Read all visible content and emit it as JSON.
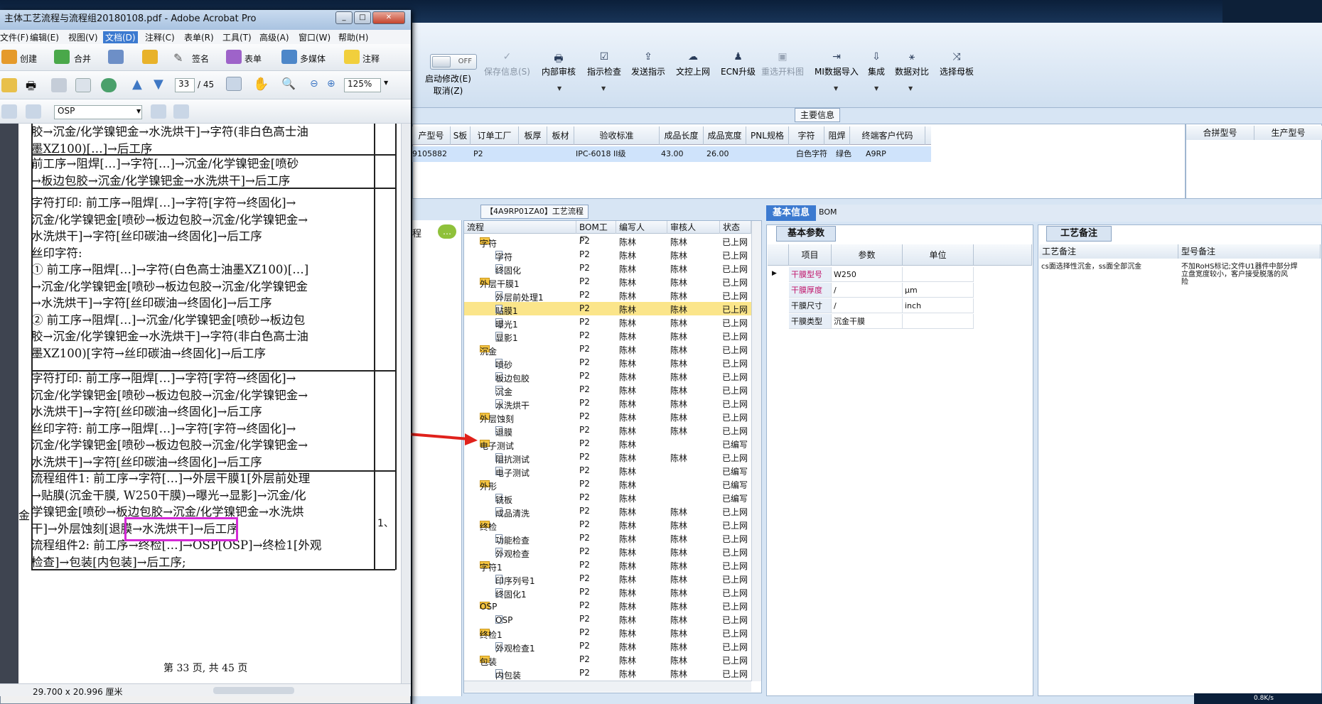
{
  "acrobat": {
    "title": "主体工艺流程与流程组20180108.pdf - Adobe Acrobat Pro",
    "menu": [
      "文件(F)",
      "编辑(E)",
      "视图(V)",
      "文档(D)",
      "注释(C)",
      "表单(R)",
      "工具(T)",
      "高级(A)",
      "窗口(W)",
      "帮助(H)"
    ],
    "toolbar1": [
      "创建",
      "合并",
      "签名",
      "表单",
      "多媒体",
      "注释"
    ],
    "page_current": "33",
    "page_total": "/ 45",
    "zoom": "125%",
    "layer_select": "OSP",
    "status_size": "29.700 x 20.996 厘米",
    "footer": "第 33 页, 共 45 页",
    "left_margin_text": "金",
    "right_margin_text": "1、",
    "doc_cells": [
      "胶→沉金/化学镍钯金→水洗烘干]→字符(非白色高士油\n墨XZ100)[…]→后工序",
      "前工序→阻焊[…]→字符[…]→沉金/化学镍钯金[喷砂\n→板边包胶→沉金/化学镍钯金→水洗烘干]→后工序",
      "字符打印: 前工序→阻焊[…]→字符[字符→终固化]→\n沉金/化学镍钯金[喷砂→板边包胶→沉金/化学镍钯金→\n水洗烘干]→字符[丝印碳油→终固化]→后工序\n丝印字符:\n① 前工序→阻焊[…]→字符(白色高士油墨XZ100)[…]\n→沉金/化学镍钯金[喷砂→板边包胶→沉金/化学镍钯金\n→水洗烘干]→字符[丝印碳油→终固化]→后工序\n② 前工序→阻焊[…]→沉金/化学镍钯金[喷砂→板边包\n胶→沉金/化学镍钯金→水洗烘干]→字符(非白色高士油\n墨XZ100)[字符→丝印碳油→终固化]→后工序",
      "字符打印: 前工序→阻焊[…]→字符[字符→终固化]→\n沉金/化学镍钯金[喷砂→板边包胶→沉金/化学镍钯金→\n水洗烘干]→字符[丝印碳油→终固化]→后工序\n丝印字符: 前工序→阻焊[…]→字符[字符→终固化]→\n沉金/化学镍钯金[喷砂→板边包胶→沉金/化学镍钯金→\n水洗烘干]→字符[丝印碳油→终固化]→后工序",
      "流程组件1: 前工序→字符[…]→外层干膜1[外层前处理\n→贴膜(沉金干膜, W250干膜)→曝光→显影]→沉金/化\n学镍钯金[喷砂→板边包胶→沉金/化学镍钯金→水洗烘\n干]→外层蚀刻[退膜→水洗烘干]→后工序\n流程组件2: 前工序→终检[…]→OSP[OSP]→终检1[外观\n检查]→包装[内包装]→后工序;"
    ]
  },
  "mes": {
    "toggle": "OFF",
    "toolbar": [
      {
        "label": "启动修改(E)",
        "sub": "取消(Z)"
      },
      {
        "label": "保存信息(S)",
        "disabled": true
      },
      {
        "label": "内部审核"
      },
      {
        "label": "指示检查"
      },
      {
        "label": "发送指示"
      },
      {
        "label": "文控上网"
      },
      {
        "label": "ECN升级"
      },
      {
        "label": "重选开料图",
        "disabled": true
      },
      {
        "label": "MI数据导入"
      },
      {
        "label": "集成"
      },
      {
        "label": "数据对比"
      },
      {
        "label": "选择母板"
      }
    ],
    "main_info_tab": "主要信息",
    "grid_headers": [
      "产型号",
      "S板",
      "订单工厂",
      "板厚",
      "板材",
      "验收标准",
      "成品长度",
      "成品宽度",
      "PNL规格",
      "字符",
      "阻焊",
      "终端客户代码"
    ],
    "grid_row": [
      "9105882",
      "",
      "P2",
      "",
      "",
      "IPC-6018 II级",
      "43.00",
      "26.00",
      "",
      "白色字符",
      "绿色",
      "A9RP"
    ],
    "grid_right_headers": [
      "合拼型号",
      "生产型号"
    ],
    "left_panel_label": "程",
    "flow_tab": "【4A9RP01ZA0】工艺流程",
    "tree_headers": [
      "流程",
      "BOM工厂",
      "编写人",
      "审核人",
      "状态"
    ],
    "tree_rows": [
      {
        "level": 1,
        "type": "folder",
        "name": "字符",
        "factory": "P2",
        "writer": "陈林",
        "reviewer": "陈林",
        "status": "已上网"
      },
      {
        "level": 2,
        "type": "doc",
        "name": "字符",
        "factory": "P2",
        "writer": "陈林",
        "reviewer": "陈林",
        "status": "已上网"
      },
      {
        "level": 2,
        "type": "doc",
        "name": "终固化",
        "factory": "P2",
        "writer": "陈林",
        "reviewer": "陈林",
        "status": "已上网"
      },
      {
        "level": 1,
        "type": "folder",
        "name": "外层干膜1",
        "factory": "P2",
        "writer": "陈林",
        "reviewer": "陈林",
        "status": "已上网"
      },
      {
        "level": 2,
        "type": "doc",
        "name": "外层前处理1",
        "factory": "P2",
        "writer": "陈林",
        "reviewer": "陈林",
        "status": "已上网"
      },
      {
        "level": 2,
        "type": "doc",
        "name": "贴膜1",
        "factory": "P2",
        "writer": "陈林",
        "reviewer": "陈林",
        "status": "已上网",
        "selected": true
      },
      {
        "level": 2,
        "type": "doc",
        "name": "曝光1",
        "factory": "P2",
        "writer": "陈林",
        "reviewer": "陈林",
        "status": "已上网"
      },
      {
        "level": 2,
        "type": "doc",
        "name": "显影1",
        "factory": "P2",
        "writer": "陈林",
        "reviewer": "陈林",
        "status": "已上网"
      },
      {
        "level": 1,
        "type": "folder",
        "name": "沉金",
        "factory": "P2",
        "writer": "陈林",
        "reviewer": "陈林",
        "status": "已上网"
      },
      {
        "level": 2,
        "type": "doc",
        "name": "喷砂",
        "factory": "P2",
        "writer": "陈林",
        "reviewer": "陈林",
        "status": "已上网"
      },
      {
        "level": 2,
        "type": "doc",
        "name": "板边包胶",
        "factory": "P2",
        "writer": "陈林",
        "reviewer": "陈林",
        "status": "已上网"
      },
      {
        "level": 2,
        "type": "doc",
        "name": "沉金",
        "factory": "P2",
        "writer": "陈林",
        "reviewer": "陈林",
        "status": "已上网"
      },
      {
        "level": 2,
        "type": "doc",
        "name": "水洗烘干",
        "factory": "P2",
        "writer": "陈林",
        "reviewer": "陈林",
        "status": "已上网"
      },
      {
        "level": 1,
        "type": "folder",
        "name": "外层蚀刻",
        "factory": "P2",
        "writer": "陈林",
        "reviewer": "陈林",
        "status": "已上网"
      },
      {
        "level": 2,
        "type": "doc",
        "name": "退膜",
        "factory": "P2",
        "writer": "陈林",
        "reviewer": "陈林",
        "status": "已上网"
      },
      {
        "level": 1,
        "type": "folder",
        "name": "电子测试",
        "factory": "P2",
        "writer": "陈林",
        "reviewer": "",
        "status": "已编写"
      },
      {
        "level": 2,
        "type": "doc",
        "name": "阻抗测试",
        "factory": "P2",
        "writer": "陈林",
        "reviewer": "陈林",
        "status": "已上网"
      },
      {
        "level": 2,
        "type": "doc",
        "name": "电子测试",
        "factory": "P2",
        "writer": "陈林",
        "reviewer": "",
        "status": "已编写"
      },
      {
        "level": 1,
        "type": "folder",
        "name": "外形",
        "factory": "P2",
        "writer": "陈林",
        "reviewer": "",
        "status": "已编写"
      },
      {
        "level": 2,
        "type": "doc",
        "name": "铣板",
        "factory": "P2",
        "writer": "陈林",
        "reviewer": "",
        "status": "已编写"
      },
      {
        "level": 2,
        "type": "doc",
        "name": "成品清洗",
        "factory": "P2",
        "writer": "陈林",
        "reviewer": "陈林",
        "status": "已上网"
      },
      {
        "level": 1,
        "type": "folder",
        "name": "终检",
        "factory": "P2",
        "writer": "陈林",
        "reviewer": "陈林",
        "status": "已上网"
      },
      {
        "level": 2,
        "type": "doc",
        "name": "功能检查",
        "factory": "P2",
        "writer": "陈林",
        "reviewer": "陈林",
        "status": "已上网"
      },
      {
        "level": 2,
        "type": "doc",
        "name": "外观检查",
        "factory": "P2",
        "writer": "陈林",
        "reviewer": "陈林",
        "status": "已上网"
      },
      {
        "level": 1,
        "type": "folder",
        "name": "字符1",
        "factory": "P2",
        "writer": "陈林",
        "reviewer": "陈林",
        "status": "已上网"
      },
      {
        "level": 2,
        "type": "doc",
        "name": "印序列号1",
        "factory": "P2",
        "writer": "陈林",
        "reviewer": "陈林",
        "status": "已上网"
      },
      {
        "level": 2,
        "type": "doc",
        "name": "终固化1",
        "factory": "P2",
        "writer": "陈林",
        "reviewer": "陈林",
        "status": "已上网"
      },
      {
        "level": 1,
        "type": "folder",
        "name": "OSP",
        "factory": "P2",
        "writer": "陈林",
        "reviewer": "陈林",
        "status": "已上网"
      },
      {
        "level": 2,
        "type": "doc",
        "name": "OSP",
        "factory": "P2",
        "writer": "陈林",
        "reviewer": "陈林",
        "status": "已上网"
      },
      {
        "level": 1,
        "type": "folder",
        "name": "终检1",
        "factory": "P2",
        "writer": "陈林",
        "reviewer": "陈林",
        "status": "已上网"
      },
      {
        "level": 2,
        "type": "doc",
        "name": "外观检查1",
        "factory": "P2",
        "writer": "陈林",
        "reviewer": "陈林",
        "status": "已上网"
      },
      {
        "level": 1,
        "type": "folder",
        "name": "包装",
        "factory": "P2",
        "writer": "陈林",
        "reviewer": "陈林",
        "status": "已上网"
      },
      {
        "level": 2,
        "type": "doc",
        "name": "内包装",
        "factory": "P2",
        "writer": "陈林",
        "reviewer": "陈林",
        "status": "已上网"
      }
    ],
    "tabs": [
      "基本信息",
      "BOM"
    ],
    "params_title": "基本参数",
    "params_headers": [
      "项目",
      "参数",
      "单位"
    ],
    "params_rows": [
      {
        "item": "干膜型号",
        "value": "W250",
        "unit": "",
        "highlight": true
      },
      {
        "item": "干膜厚度",
        "value": "/",
        "unit": "μm",
        "highlight": true
      },
      {
        "item": "干膜尺寸",
        "value": "/",
        "unit": "inch",
        "highlight": false
      },
      {
        "item": "干膜类型",
        "value": "沉金干膜",
        "unit": "",
        "highlight": false
      }
    ],
    "notes_title": "工艺备注",
    "notes_headers": [
      "工艺备注",
      "型号备注"
    ],
    "process_note": "cs面选择性沉金，ss面全部沉金",
    "model_note": "不加RoHS标记;文件U1器件中部分焊\n立盘宽度较小，客户接受脱落的风\n险",
    "net_speed": "0.8K/s"
  }
}
